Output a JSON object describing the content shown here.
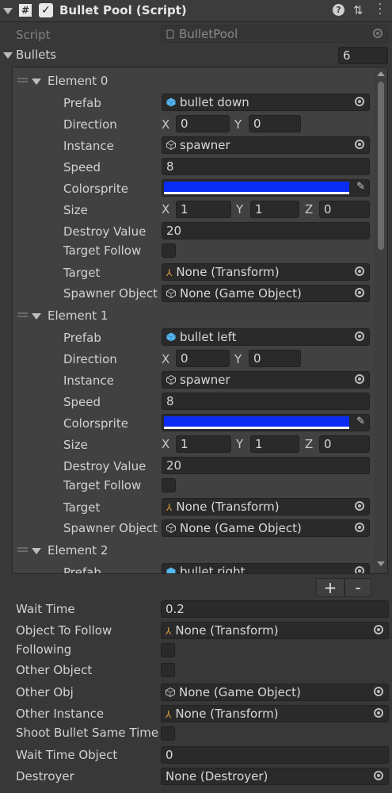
{
  "header": {
    "title": "Bullet Pool (Script)"
  },
  "script": {
    "label": "Script",
    "value": "BulletPool"
  },
  "bullets": {
    "label": "Bullets",
    "size": "6"
  },
  "elements": [
    {
      "name": "Element 0",
      "labels": {
        "prefab": "Prefab",
        "direction": "Direction",
        "instance": "Instance",
        "speed": "Speed",
        "colorsprite": "Colorsprite",
        "size": "Size",
        "destroy_value": "Destroy Value",
        "target_follow": "Target Follow",
        "target": "Target",
        "spawner_object": "Spawner Object"
      },
      "prefab": "bullet down",
      "direction": {
        "x": "0",
        "y": "0"
      },
      "instance": "spawner",
      "speed": "8",
      "color": "#0a2df5",
      "size": {
        "x": "1",
        "y": "1",
        "z": "0"
      },
      "destroy_value": "20",
      "target": "None (Transform)",
      "spawner_object": "None (Game Object)"
    },
    {
      "name": "Element 1",
      "labels": {
        "prefab": "Prefab",
        "direction": "Direction",
        "instance": "Instance",
        "speed": "Speed",
        "colorsprite": "Colorsprite",
        "size": "Size",
        "destroy_value": "Destroy Value",
        "target_follow": "Target Follow",
        "target": "Target",
        "spawner_object": "Spawner Object"
      },
      "prefab": "bullet left",
      "direction": {
        "x": "0",
        "y": "0"
      },
      "instance": "spawner",
      "speed": "8",
      "color": "#0a2df5",
      "size": {
        "x": "1",
        "y": "1",
        "z": "0"
      },
      "destroy_value": "20",
      "target": "None (Transform)",
      "spawner_object": "None (Game Object)"
    },
    {
      "name": "Element 2",
      "labels": {
        "prefab": "Prefab"
      },
      "prefab": "bullet right"
    }
  ],
  "axes": {
    "x": "X",
    "y": "Y",
    "z": "Z"
  },
  "list_buttons": {
    "add": "+",
    "remove": "-"
  },
  "fields": {
    "wait_time": {
      "label": "Wait Time",
      "value": "0.2"
    },
    "object_to_follow": {
      "label": "Object To Follow",
      "value": "None (Transform)"
    },
    "following": {
      "label": "Following"
    },
    "other_object": {
      "label": "Other Object"
    },
    "other_obj": {
      "label": "Other Obj",
      "value": "None (Game Object)"
    },
    "other_instance": {
      "label": "Other Instance",
      "value": "None (Transform)"
    },
    "shoot_same_time": {
      "label": "Shoot Bullet Same Time"
    },
    "wait_time_object": {
      "label": "Wait Time Object",
      "value": "0"
    },
    "destroyer": {
      "label": "Destroyer",
      "value": "None (Destroyer)"
    }
  }
}
